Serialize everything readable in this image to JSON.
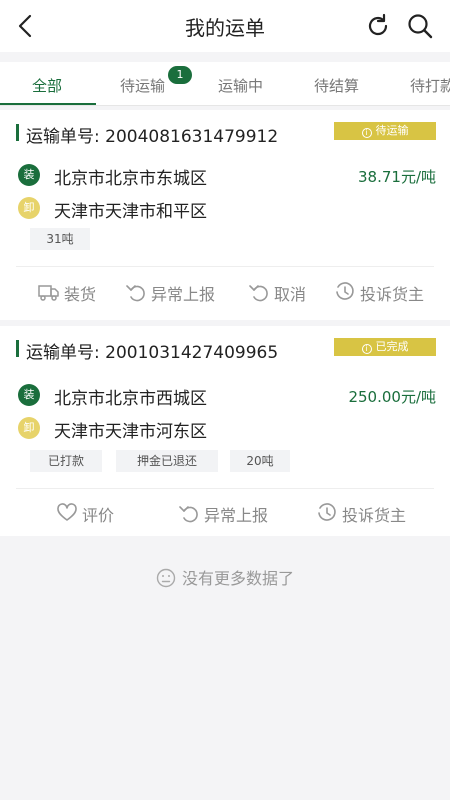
{
  "header": {
    "title": "我的运单",
    "back_icon": "chevron-left-icon",
    "refresh_icon": "refresh-icon",
    "search_icon": "search-icon"
  },
  "tabs": [
    {
      "label": "全部",
      "active": true
    },
    {
      "label": "待运输",
      "badge": "1"
    },
    {
      "label": "运输中"
    },
    {
      "label": "待结算"
    },
    {
      "label": "待打款"
    }
  ],
  "orders": [
    {
      "order_label": "运输单号: 2004081631479912",
      "status": "待运输",
      "load_badge": "装",
      "load_location": "北京市北京市东城区",
      "unload_badge": "卸",
      "unload_location": "天津市天津市和平区",
      "price": "38.71元/吨",
      "chips": [
        "31吨"
      ],
      "actions": [
        "装货",
        "异常上报",
        "取消",
        "投诉货主"
      ]
    },
    {
      "order_label": "运输单号: 2001031427409965",
      "status": "已完成",
      "load_badge": "装",
      "load_location": "北京市北京市西城区",
      "unload_badge": "卸",
      "unload_location": "天津市天津市河东区",
      "price": "250.00元/吨",
      "chips": [
        "已打款",
        "押金已退还",
        "20吨"
      ],
      "actions": [
        "评价",
        "异常上报",
        "投诉货主"
      ]
    }
  ],
  "footer": {
    "no_more": "没有更多数据了"
  },
  "colors": {
    "accent": "#1a6e3c",
    "status_tag": "#d8c444",
    "unload_badge": "#e7d36a"
  }
}
